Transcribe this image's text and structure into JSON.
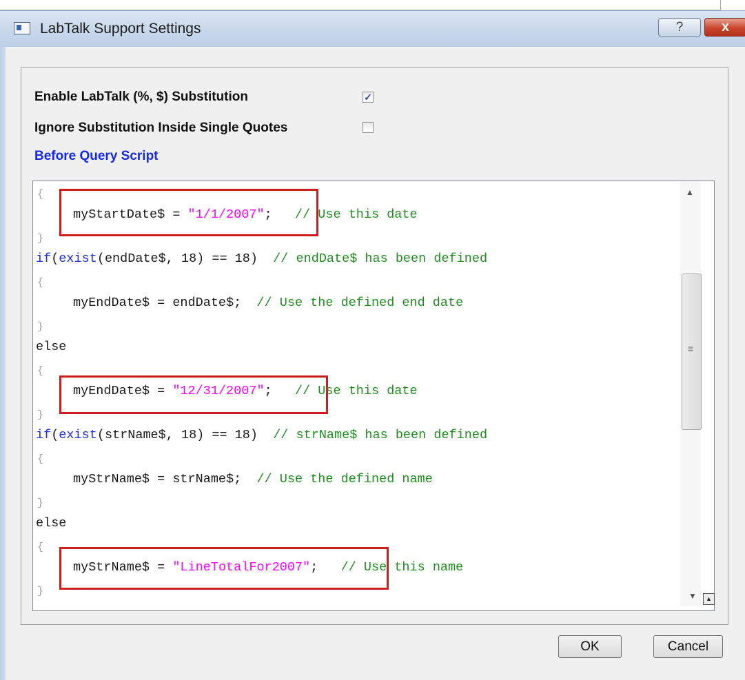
{
  "window": {
    "title": "LabTalk Support Settings",
    "help_label": "?",
    "close_label": "x"
  },
  "options": {
    "enable_substitution": {
      "label": "Enable LabTalk (%, $) Substitution",
      "checked": true,
      "mark": "✓"
    },
    "ignore_quotes": {
      "label": "Ignore Substitution Inside Single Quotes",
      "checked": false,
      "mark": ""
    }
  },
  "script_section": {
    "label": "Before Query Script"
  },
  "script": {
    "l1": "{",
    "l2_var": "myStartDate$ = ",
    "l2_str": "\"1/1/2007\"",
    "l2_end": ";",
    "l2_cmt": "// Use this date",
    "l3": "}",
    "l4_kw1": "if",
    "l4_p1": "(",
    "l4_kw2": "exist",
    "l4_body": "(endDate$, 18) == 18)",
    "l4_cmt": "// endDate$ has been defined",
    "l5": "{",
    "l6_var": "myEndDate$ = endDate$;",
    "l6_cmt": "// Use the defined end date",
    "l7": "}",
    "l8": "else",
    "l9": "{",
    "l10_var": "myEndDate$ = ",
    "l10_str": "\"12/31/2007\"",
    "l10_end": ";",
    "l10_cmt": "// Use this date",
    "l11": "}",
    "l12_kw1": "if",
    "l12_p1": "(",
    "l12_kw2": "exist",
    "l12_body": "(strName$, 18) == 18)",
    "l12_cmt": "// strName$ has been defined",
    "l13": "{",
    "l14_var": "myStrName$ = strName$;",
    "l14_cmt": "// Use the defined name",
    "l15": "}",
    "l16": "else",
    "l17": "{",
    "l18_var": "myStrName$ = ",
    "l18_str": "\"LineTotalFor2007\"",
    "l18_end": ";",
    "l18_cmt": "// Use this name",
    "l19": "}"
  },
  "scrollbar": {
    "up_arrow": "▲",
    "grip": "≡",
    "down_arrow": "▼",
    "small_button": "▲"
  },
  "buttons": {
    "ok": "OK",
    "cancel": "Cancel"
  }
}
